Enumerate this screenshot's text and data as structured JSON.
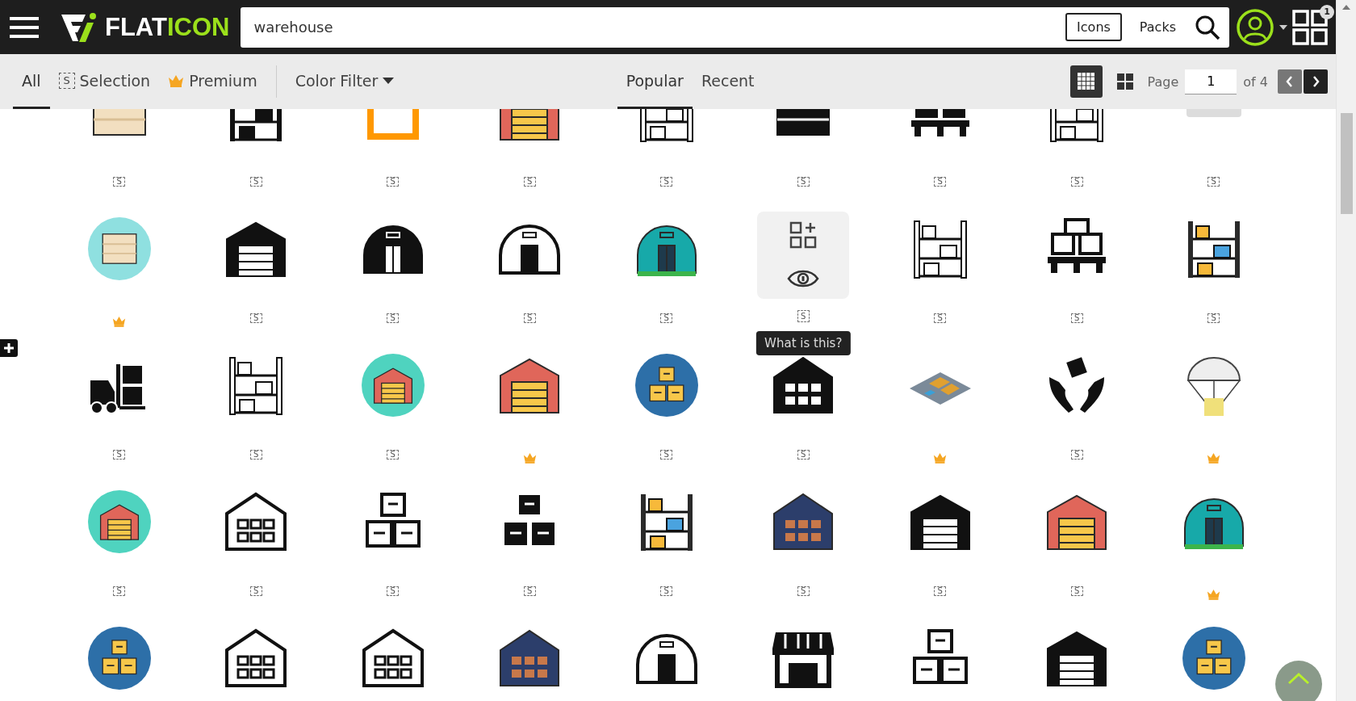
{
  "header": {
    "logo_left": "FLAT",
    "logo_right": "ICON",
    "search": {
      "value": "warehouse"
    },
    "search_types": [
      {
        "label": "Icons",
        "selected": true
      },
      {
        "label": "Packs",
        "selected": false
      }
    ],
    "collections_count": "1"
  },
  "filters": [
    {
      "label": "All",
      "kind": "plain",
      "selected": true
    },
    {
      "label": "Selection",
      "kind": "selection",
      "badge": "S",
      "selected": false
    },
    {
      "label": "Premium",
      "kind": "premium",
      "selected": false
    }
  ],
  "color_filter": "Color Filter",
  "sort_tabs": [
    {
      "label": "Popular",
      "selected": true
    },
    {
      "label": "Recent",
      "selected": false
    }
  ],
  "views": [
    {
      "kind": "small",
      "selected": true
    },
    {
      "kind": "large",
      "selected": false
    }
  ],
  "pagination": {
    "label": "Page",
    "value": "1",
    "total": "of 4",
    "prev_disabled": true,
    "next_disabled": false
  },
  "icons": [
    {
      "kind": "crate",
      "badge": {
        "kind": "selection",
        "label": "S"
      }
    },
    {
      "kind": "shelf",
      "badge": {
        "kind": "selection",
        "label": "S"
      }
    },
    {
      "kind": "frame",
      "badge": {
        "kind": "selection",
        "label": "S"
      }
    },
    {
      "kind": "garage",
      "badge": {
        "kind": "selection",
        "label": "S"
      }
    },
    {
      "kind": "shelf",
      "badge": {
        "kind": "selection",
        "label": "S"
      }
    },
    {
      "kind": "crate",
      "badge": {
        "kind": "selection",
        "label": "S"
      }
    },
    {
      "kind": "pallet",
      "badge": {
        "kind": "selection",
        "label": "S"
      }
    },
    {
      "kind": "shelf",
      "badge": {
        "kind": "selection",
        "label": "S"
      }
    },
    {
      "kind": "machine",
      "badge": {
        "kind": "selection",
        "label": "S"
      }
    },
    {
      "kind": "crate",
      "badge": {
        "kind": "premium"
      }
    },
    {
      "kind": "garage",
      "badge": {
        "kind": "selection",
        "label": "S"
      }
    },
    {
      "kind": "hangar",
      "badge": {
        "kind": "selection",
        "label": "S"
      }
    },
    {
      "kind": "hangar",
      "badge": {
        "kind": "selection",
        "label": "S"
      }
    },
    {
      "kind": "hangar",
      "badge": {
        "kind": "selection",
        "label": "S"
      }
    },
    {
      "hovered": true,
      "tooltip": "What is this?",
      "badge": {
        "kind": "selection",
        "label": "S"
      }
    },
    {
      "kind": "shelf",
      "badge": {
        "kind": "selection",
        "label": "S"
      }
    },
    {
      "kind": "pallet",
      "badge": {
        "kind": "selection",
        "label": "S"
      }
    },
    {
      "kind": "shelf",
      "badge": {
        "kind": "selection",
        "label": "S"
      }
    },
    {
      "kind": "forklift",
      "badge": {
        "kind": "selection",
        "label": "S"
      }
    },
    {
      "kind": "shelf",
      "badge": {
        "kind": "selection",
        "label": "S"
      }
    },
    {
      "kind": "garage",
      "badge": {
        "kind": "selection",
        "label": "S"
      }
    },
    {
      "kind": "garage",
      "badge": {
        "kind": "premium"
      }
    },
    {
      "kind": "boxes",
      "badge": {
        "kind": "selection",
        "label": "S"
      }
    },
    {
      "kind": "warehouse",
      "badge": {
        "kind": "selection",
        "label": "S"
      }
    },
    {
      "kind": "isometric",
      "badge": {
        "kind": "premium"
      }
    },
    {
      "kind": "hands",
      "badge": {
        "kind": "selection",
        "label": "S"
      }
    },
    {
      "kind": "parachute",
      "badge": {
        "kind": "premium"
      }
    },
    {
      "kind": "garage",
      "badge": {
        "kind": "selection",
        "label": "S"
      }
    },
    {
      "kind": "warehouse",
      "badge": {
        "kind": "selection",
        "label": "S"
      }
    },
    {
      "kind": "boxes",
      "badge": {
        "kind": "selection",
        "label": "S"
      }
    },
    {
      "kind": "boxes",
      "badge": {
        "kind": "selection",
        "label": "S"
      }
    },
    {
      "kind": "shelf",
      "badge": {
        "kind": "selection",
        "label": "S"
      }
    },
    {
      "kind": "warehouse",
      "badge": {
        "kind": "selection",
        "label": "S"
      }
    },
    {
      "kind": "garage",
      "badge": {
        "kind": "selection",
        "label": "S"
      }
    },
    {
      "kind": "garage",
      "badge": {
        "kind": "selection",
        "label": "S"
      }
    },
    {
      "kind": "hangar",
      "badge": {
        "kind": "premium"
      }
    },
    {
      "kind": "boxes"
    },
    {
      "kind": "warehouse"
    },
    {
      "kind": "warehouse"
    },
    {
      "kind": "warehouse"
    },
    {
      "kind": "hangar"
    },
    {
      "kind": "store"
    },
    {
      "kind": "boxes"
    },
    {
      "kind": "garage"
    },
    {
      "kind": "boxes"
    }
  ]
}
